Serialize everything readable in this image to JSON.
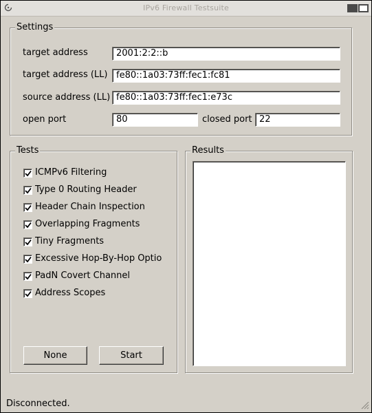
{
  "window": {
    "title": "IPv6 Firewall Testsuite",
    "icons": {
      "app": "ring-icon",
      "minimize": "minimize-icon",
      "maximize": "maximize-icon"
    }
  },
  "settings": {
    "legend": "Settings",
    "target_address": {
      "label": "target address",
      "value": "2001:2:2::b"
    },
    "target_address_ll": {
      "label": "target address (LL)",
      "value": "fe80::1a03:73ff:fec1:fc81"
    },
    "source_address_ll": {
      "label": "source address (LL)",
      "value": "fe80::1a03:73ff:fec1:e73c"
    },
    "open_port": {
      "label": "open port",
      "value": "80"
    },
    "closed_port": {
      "label": "closed port",
      "value": "22"
    }
  },
  "tests": {
    "legend": "Tests",
    "items": [
      {
        "label": "ICMPv6 Filtering",
        "checked": true
      },
      {
        "label": "Type 0 Routing Header",
        "checked": true
      },
      {
        "label": "Header Chain Inspection",
        "checked": true
      },
      {
        "label": "Overlapping Fragments",
        "checked": true
      },
      {
        "label": "Tiny Fragments",
        "checked": true
      },
      {
        "label": "Excessive Hop-By-Hop Optio",
        "checked": true
      },
      {
        "label": "PadN Covert Channel",
        "checked": true
      },
      {
        "label": "Address Scopes",
        "checked": true
      }
    ],
    "none_button": "None",
    "start_button": "Start"
  },
  "results": {
    "legend": "Results"
  },
  "status": "Disconnected."
}
